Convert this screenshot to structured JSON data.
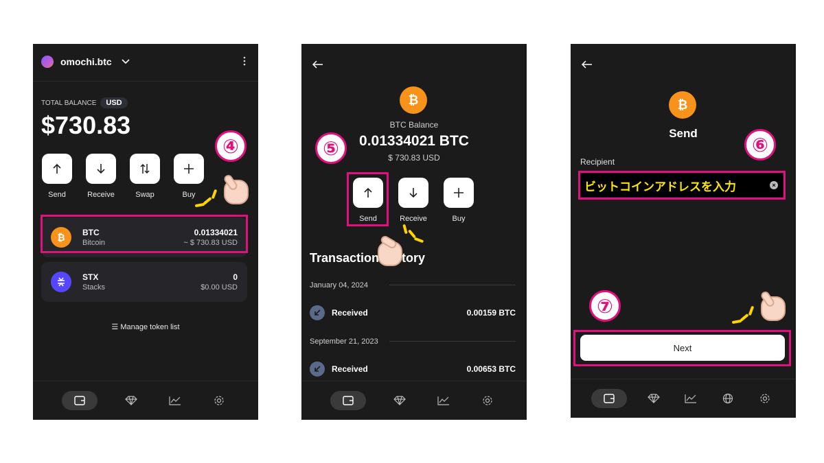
{
  "panel1": {
    "account_name": "omochi.btc",
    "total_balance_label": "TOTAL BALANCE",
    "currency": "USD",
    "balance": "$730.83",
    "actions": [
      {
        "label": "Send",
        "icon": "arrow-up-icon"
      },
      {
        "label": "Receive",
        "icon": "arrow-down-icon"
      },
      {
        "label": "Swap",
        "icon": "swap-icon"
      },
      {
        "label": "Buy",
        "icon": "plus-icon"
      }
    ],
    "tokens": [
      {
        "symbol": "BTC",
        "name": "Bitcoin",
        "amount": "0.01334021",
        "usd": "~ $ 730.83 USD",
        "icon": "bitcoin-icon"
      },
      {
        "symbol": "STX",
        "name": "Stacks",
        "amount": "0",
        "usd": "$0.00 USD",
        "icon": "stacks-icon"
      }
    ],
    "manage_label": "Manage token list",
    "step": "④"
  },
  "panel2": {
    "balance_label": "BTC Balance",
    "balance": "0.01334021 BTC",
    "usd": "$ 730.83 USD",
    "actions": [
      {
        "label": "Send",
        "icon": "arrow-up-icon"
      },
      {
        "label": "Receive",
        "icon": "arrow-down-icon"
      },
      {
        "label": "Buy",
        "icon": "plus-icon"
      }
    ],
    "history_title": "Transaction History",
    "transactions": [
      {
        "date": "January 04, 2024",
        "label": "Received",
        "amount": "0.00159 BTC"
      },
      {
        "date": "September 21, 2023",
        "label": "Received",
        "amount": "0.00653 BTC"
      }
    ],
    "step": "⑤"
  },
  "panel3": {
    "title": "Send",
    "recipient_label": "Recipient",
    "recipient_placeholder": "ビットコインアドレスを入力",
    "next_label": "Next",
    "step_recipient": "⑥",
    "step_next": "⑦"
  },
  "colors": {
    "accent": "#e0107e",
    "btc": "#f7931a",
    "stx": "#5546ff",
    "panel_bg": "#1b1b1b"
  }
}
